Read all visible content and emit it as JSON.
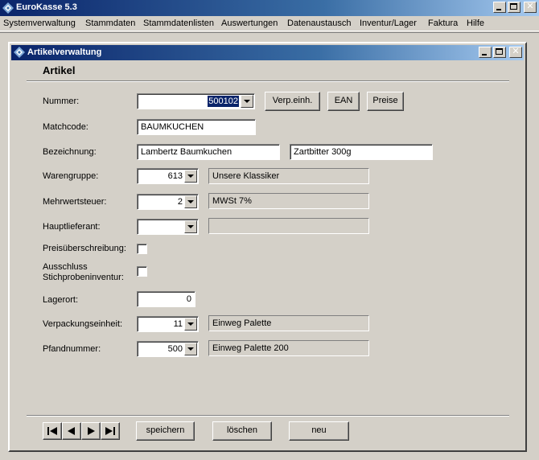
{
  "app": {
    "title": "EuroKasse 5.3"
  },
  "menu": [
    "Systemverwaltung",
    "Stammdaten",
    "Stammdatenlisten",
    "Auswertungen",
    "Datenaustausch",
    "Inventur/Lager",
    "Faktura",
    "Hilfe"
  ],
  "window": {
    "title": "Artikelverwaltung",
    "heading": "Artikel"
  },
  "labels": {
    "nummer": "Nummer:",
    "matchcode": "Matchcode:",
    "bezeichnung": "Bezeichnung:",
    "warengruppe": "Warengruppe:",
    "mwst": "Mehrwertsteuer:",
    "hauptlieferant": "Hauptlieferant:",
    "preisueberschreibung": "Preisüberschreibung:",
    "ausschluss_line1": "Ausschluss",
    "ausschluss_line2": "Stichprobeninventur:",
    "lagerort": "Lagerort:",
    "verpackungseinheit": "Verpackungseinheit:",
    "pfandnummer": "Pfandnummer:"
  },
  "values": {
    "nummer": "500102",
    "matchcode": "BAUMKUCHEN",
    "bezeichnung1": "Lambertz Baumkuchen",
    "bezeichnung2": "Zartbitter 300g",
    "warengruppe": "613",
    "warengruppe_text": "Unsere Klassiker",
    "mwst": "2",
    "mwst_text": "MWSt 7%",
    "hauptlieferant": "",
    "hauptlieferant_text": "",
    "preisueberschreibung": false,
    "ausschluss_stichprobe": false,
    "lagerort": "0",
    "verpackungseinheit": "11",
    "verpackungseinheit_text": "Einweg Palette",
    "pfandnummer": "500",
    "pfandnummer_text": "Einweg Palette 200"
  },
  "buttons": {
    "verp_einh": "Verp.einh.",
    "ean": "EAN",
    "preise": "Preise",
    "speichern": "speichern",
    "loeschen": "löschen",
    "neu": "neu"
  },
  "nav_icons": [
    "first-record-icon",
    "prev-record-icon",
    "next-record-icon",
    "last-record-icon"
  ]
}
